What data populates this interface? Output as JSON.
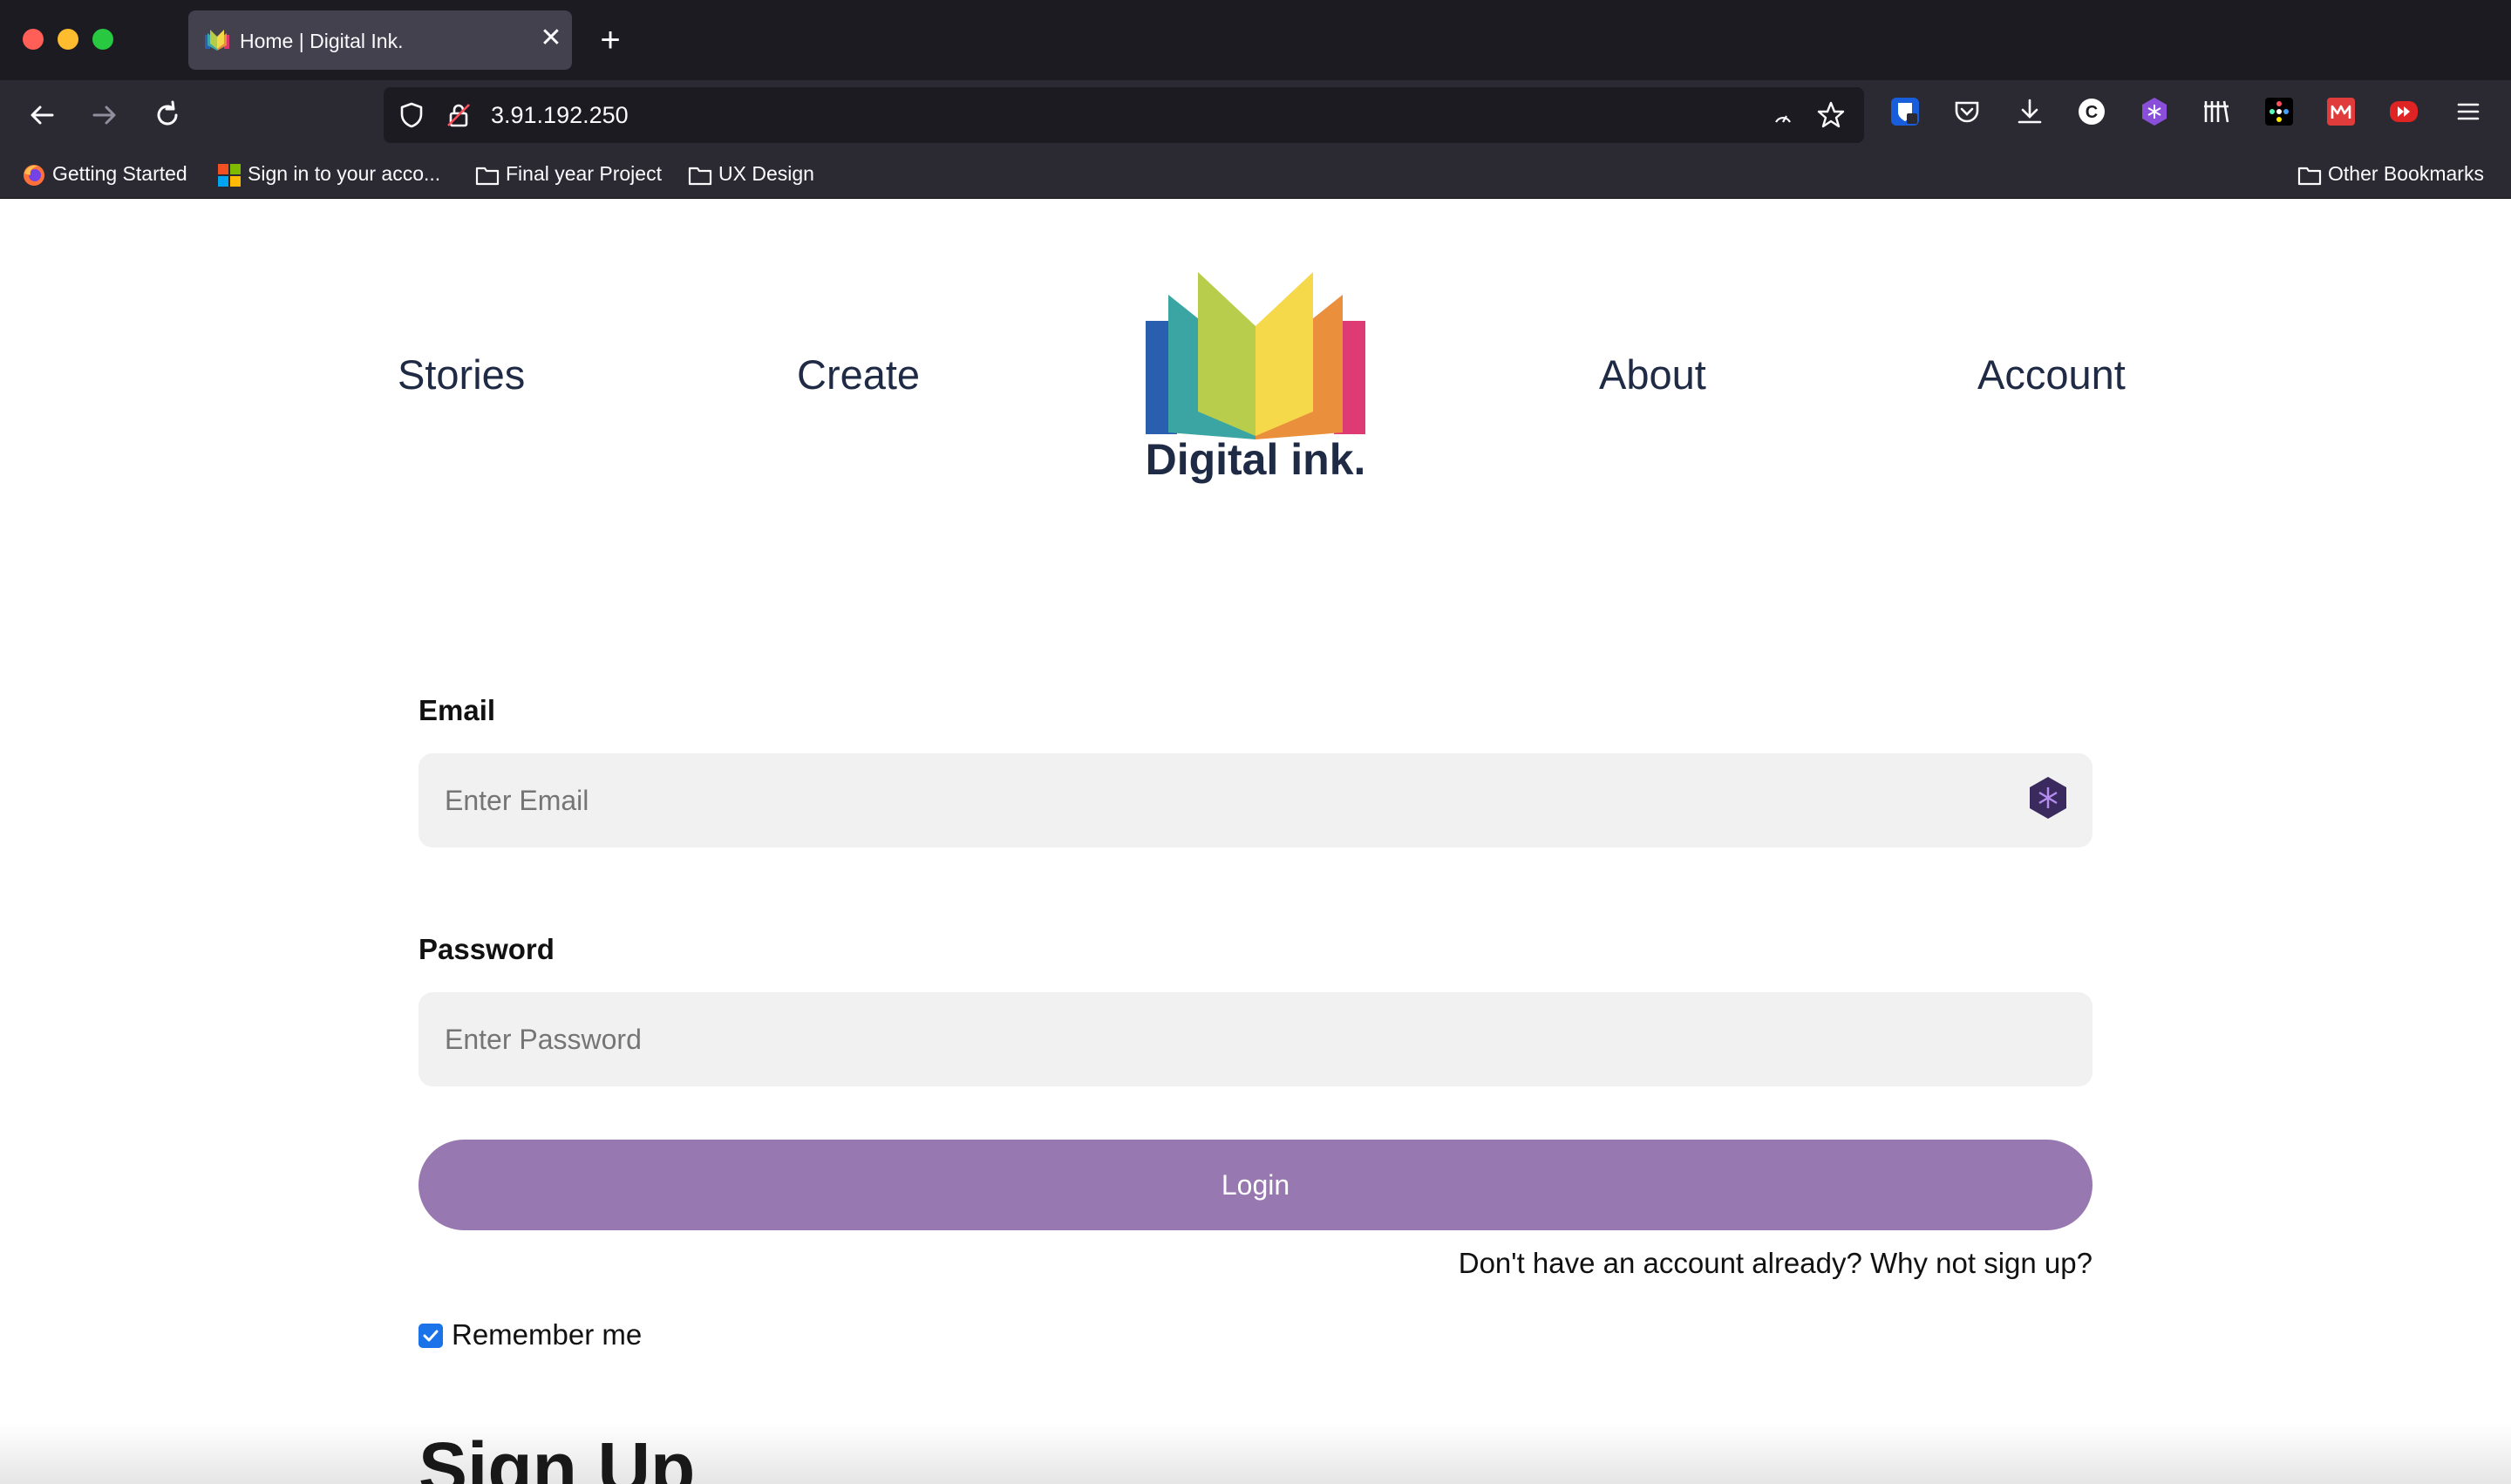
{
  "browser": {
    "tab_title": "Home | Digital Ink.",
    "tab_close_glyph": "✕",
    "new_tab_glyph": "+",
    "url": "3.91.192.250",
    "bookmarks": [
      {
        "label": "Getting Started",
        "icon": "firefox-icon"
      },
      {
        "label": "Sign in to your acco...",
        "icon": "microsoft-icon"
      },
      {
        "label": "Final year Project",
        "icon": "folder-icon"
      },
      {
        "label": "UX Design",
        "icon": "folder-icon"
      }
    ],
    "other_bookmarks": "Other Bookmarks",
    "extensions": [
      "bitwarden-icon",
      "pocket-icon",
      "downloads-icon",
      "c-extension-icon",
      "hexagon-extension-icon",
      "library-icon",
      "colorful-extension-icon",
      "red-m-extension-icon",
      "red-forward-extension-icon",
      "menu-icon"
    ]
  },
  "site": {
    "nav": {
      "stories": "Stories",
      "create": "Create",
      "about": "About",
      "account": "Account"
    },
    "logo_text": "Digital ink.",
    "colors": {
      "nav_text": "#1f2a44",
      "login_button": "#9878b0",
      "field_bg": "#f1f1f1",
      "checkbox": "#1a73e8"
    }
  },
  "login": {
    "email_label": "Email",
    "email_placeholder": "Enter Email",
    "password_label": "Password",
    "password_placeholder": "Enter Password",
    "login_button": "Login",
    "signup_prompt": "Don't have an account already? Why not sign up?",
    "remember_me": "Remember me",
    "remember_checked": true
  },
  "signup": {
    "heading": "Sign Up"
  }
}
